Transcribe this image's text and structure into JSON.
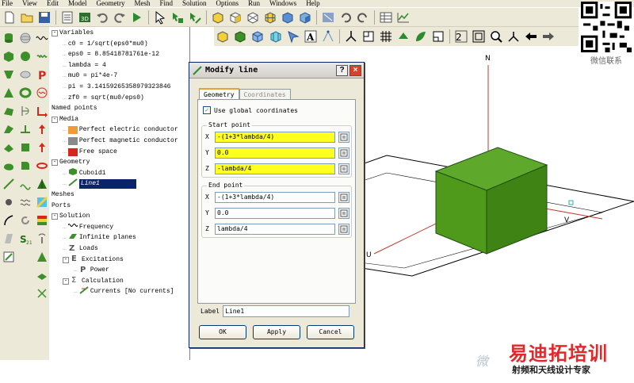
{
  "menu": [
    "File",
    "View",
    "Edit",
    "Model",
    "Geometry",
    "Mesh",
    "Find",
    "Solution",
    "Options",
    "Run",
    "Windows",
    "Help"
  ],
  "tree": {
    "items": [
      {
        "label": "Variables",
        "level": 0,
        "expander": "-"
      },
      {
        "label": "c0 = 1/sqrt(eps0*mu0)",
        "level": 1
      },
      {
        "label": "eps0 = 8.85418781761e-12",
        "level": 1
      },
      {
        "label": "lambda = 4",
        "level": 1
      },
      {
        "label": "mu0 = pi*4e-7",
        "level": 1
      },
      {
        "label": "pi = 3.14159265358979323846",
        "level": 1
      },
      {
        "label": "zf0 = sqrt(mu0/eps0)",
        "level": 1
      },
      {
        "label": "Named points",
        "level": 0
      },
      {
        "label": "Media",
        "level": 0,
        "expander": "-"
      },
      {
        "label": "Perfect electric conductor",
        "level": 1,
        "swatch": "#f09a3a"
      },
      {
        "label": "Perfect magnetic conductor",
        "level": 1,
        "swatch": "#8a8a8a"
      },
      {
        "label": "Free space",
        "level": 1,
        "swatch": "#d9261c"
      },
      {
        "label": "Geometry",
        "level": 0,
        "expander": "-"
      },
      {
        "label": "Cuboid1",
        "level": 1,
        "icon": "cuboid-icon"
      },
      {
        "label": "Line1",
        "level": 1,
        "icon": "line-icon",
        "selected": true
      },
      {
        "label": "Meshes",
        "level": 0
      },
      {
        "label": "Ports",
        "level": 0
      },
      {
        "label": "Solution",
        "level": 0,
        "expander": "-"
      },
      {
        "label": "Frequency",
        "level": 1,
        "icon": "frequency-icon"
      },
      {
        "label": "Infinite planes",
        "level": 1,
        "icon": "infinite-planes-icon"
      },
      {
        "label": "Loads",
        "level": 1,
        "icon": "loads-icon"
      },
      {
        "label": "Excitations",
        "level": 1,
        "expander": "-",
        "icon": "excitations-icon"
      },
      {
        "label": "Power",
        "level": 2,
        "icon": "power-icon"
      },
      {
        "label": "Calculation",
        "level": 1,
        "expander": "-",
        "icon": "sum-icon"
      },
      {
        "label": "Currents [No currents]",
        "level": 2,
        "icon": "currents-icon"
      }
    ]
  },
  "dialog": {
    "title": "Modify line",
    "tabs": [
      "Geometry",
      "Coordinates"
    ],
    "use_global_label": "Use global coordinates",
    "use_global_checked": true,
    "start_point": {
      "title": "Start point",
      "x_label": "X",
      "x": "-(1+3*lambda/4)",
      "y_label": "Y",
      "y": "0.0",
      "z_label": "Z",
      "z": "-lambda/4"
    },
    "end_point": {
      "title": "End point",
      "x_label": "X",
      "x": "-(1+3*lambda/4)",
      "y_label": "Y",
      "y": "0.0",
      "z_label": "Z",
      "z": "lambda/4"
    },
    "label_caption": "Label",
    "label_value": "Line1",
    "ok": "OK",
    "apply": "Apply",
    "cancel": "Cancel",
    "help_glyph": "?",
    "close_glyph": "×"
  },
  "viewport": {
    "axis_n": "N",
    "axis_u": "U",
    "axis_v": "V",
    "cube_color": "#4f9a1a"
  },
  "qr_caption": "微信联系",
  "watermark": {
    "big": "易迪拓培训",
    "small": "射频和天线设计专家",
    "faint": "微"
  }
}
